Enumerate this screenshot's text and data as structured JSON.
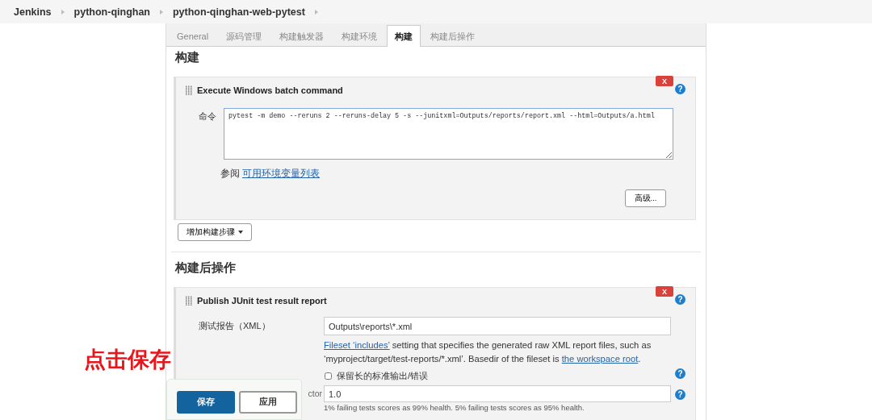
{
  "breadcrumbs": [
    {
      "label": "Jenkins"
    },
    {
      "label": "python-qinghan"
    },
    {
      "label": "python-qinghan-web-pytest"
    }
  ],
  "tabs": [
    {
      "label": "General",
      "selected": false
    },
    {
      "label": "源码管理",
      "selected": false
    },
    {
      "label": "构建触发器",
      "selected": false
    },
    {
      "label": "构建环境",
      "selected": false
    },
    {
      "label": "构建",
      "selected": true
    },
    {
      "label": "构建后操作",
      "selected": false
    }
  ],
  "build": {
    "heading": "构建",
    "step": {
      "title": "Execute Windows batch command",
      "delete": "X",
      "help": "?",
      "command_label": "命令",
      "command": "pytest -m demo --reruns 2 --reruns-delay 5 -s --junitxml=Outputs/reports/report.xml --html=Outputs/a.html",
      "see_also": "参阅",
      "env_link": "可用环境变量列表",
      "advanced_button": "高级..."
    },
    "add_step_button": "增加构建步骤"
  },
  "post_build": {
    "heading": "构建后操作",
    "step": {
      "title": "Publish JUnit test result report",
      "delete": "X",
      "help": "?",
      "report_label": "测试报告（XML）",
      "report_value": "Outputs\\reports\\*.xml",
      "report_help": [
        {
          "kind": "link",
          "text": "Fileset ‘includes’"
        },
        {
          "kind": "text",
          "text": " setting that specifies the generated raw XML report files, such as ‘myproject/target/test-reports/*.xml’. Basedir of the fileset is "
        },
        {
          "kind": "link",
          "text": "the workspace root"
        },
        {
          "kind": "text",
          "text": "."
        }
      ],
      "keep_output": {
        "label": "保留长的标准输出/错误",
        "checked": false,
        "help": "?"
      },
      "factor_label": "ctor",
      "factor_value": "1.0",
      "factor_help_icon": "?",
      "factor_help": "1% failing tests scores as 99% health. 5% failing tests scores as 95% health."
    }
  },
  "save_bar": {
    "save": "保存",
    "apply": "应用"
  },
  "annotation": "点击保存"
}
